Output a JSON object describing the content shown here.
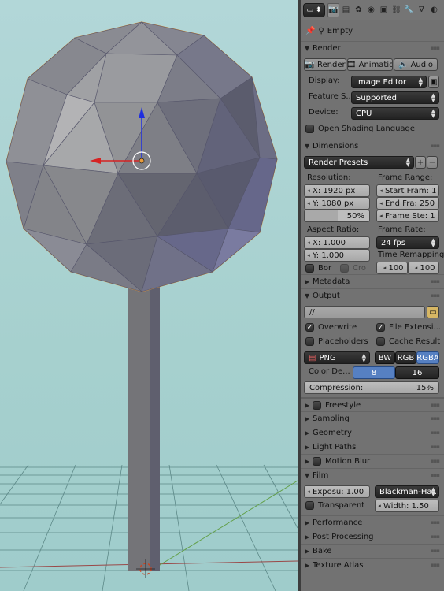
{
  "viewport": {
    "object_name": "Empty"
  },
  "header": {
    "context_label": "",
    "tabs": [
      "render-icon",
      "render-layers-icon",
      "scene-icon",
      "world-icon",
      "object-icon",
      "constraints-icon",
      "modifiers-icon",
      "data-icon",
      "texture-icon"
    ]
  },
  "path": {
    "object": "Empty"
  },
  "render": {
    "title": "Render",
    "render_btn": "Render",
    "animation_btn": "Animatio",
    "audio_btn": "Audio",
    "display_label": "Display:",
    "display_value": "Image Editor",
    "feature_label": "Feature S...",
    "feature_value": "Supported",
    "device_label": "Device:",
    "device_value": "CPU",
    "osl_label": "Open Shading Language"
  },
  "dimensions": {
    "title": "Dimensions",
    "presets": "Render Presets",
    "resolution_label": "Resolution:",
    "res_x": "X:   1920 px",
    "res_y": "Y:   1080 px",
    "res_pct": "50%",
    "frame_range_label": "Frame Range:",
    "start": "Start Fram: 1",
    "end": "End Fra:  250",
    "step": "Frame Ste: 1",
    "aspect_label": "Aspect Ratio:",
    "asp_x": "X:      1.000",
    "asp_y": "Y:      1.000",
    "frame_rate_label": "Frame Rate:",
    "fps": "24 fps",
    "remap_label": "Time Remapping:",
    "remap_old": "100",
    "remap_new": "100",
    "border_label": "Bor",
    "crop_label": "Cro"
  },
  "metadata": {
    "title": "Metadata"
  },
  "output": {
    "title": "Output",
    "path": "//",
    "overwrite": "Overwrite",
    "file_ext": "File Extensi...",
    "placeholders": "Placeholders",
    "cache": "Cache Result",
    "format": "PNG",
    "bw": "BW",
    "rgb": "RGB",
    "rgba": "RGBA",
    "color_depth_label": "Color De...",
    "depth_8": "8",
    "depth_16": "16",
    "compression": "Compression:",
    "compression_val": "15%"
  },
  "sections": {
    "freestyle": "Freestyle",
    "sampling": "Sampling",
    "geometry": "Geometry",
    "light_paths": "Light Paths",
    "motion_blur": "Motion Blur",
    "film": "Film",
    "performance": "Performance",
    "post_processing": "Post Processing",
    "bake": "Bake",
    "texture_atlas": "Texture Atlas"
  },
  "film": {
    "exposure": "Exposu: 1.00",
    "filter": "Blackman-Ha...",
    "transparent": "Transparent",
    "width": "Width:   1.50"
  },
  "colors": {
    "accent": "#5680c2",
    "panel": "#727272",
    "selection": "#e89b3c"
  }
}
